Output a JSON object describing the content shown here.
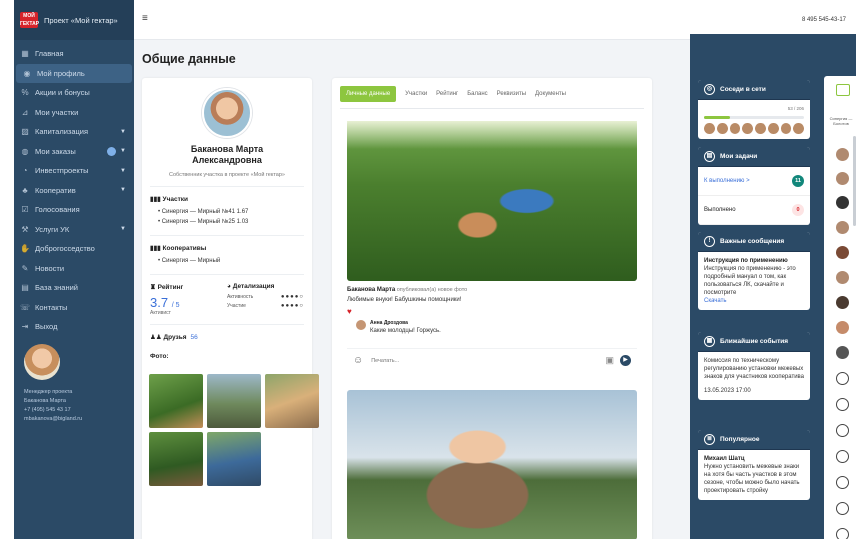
{
  "sidebar": {
    "title": "Проект «Мой гектар»",
    "logo_text": "МОЙ ГЕКТАР",
    "items": [
      {
        "label": "Главная",
        "icon": "grid-icon"
      },
      {
        "label": "Мой профиль",
        "icon": "user-icon",
        "active": true
      },
      {
        "label": "Акции и бонусы",
        "icon": "percent-icon"
      },
      {
        "label": "Мои участки",
        "icon": "plot-icon"
      },
      {
        "label": "Капитализация",
        "icon": "chart-icon",
        "expandable": true
      },
      {
        "label": "Мои заказы",
        "icon": "cart-icon",
        "expandable": true,
        "dot": true
      },
      {
        "label": "Инвестпроекты",
        "icon": "invest-icon",
        "expandable": true
      },
      {
        "label": "Кооператив",
        "icon": "coop-icon",
        "expandable": true
      },
      {
        "label": "Голосования",
        "icon": "vote-icon"
      },
      {
        "label": "Услуги УК",
        "icon": "service-icon",
        "expandable": true
      },
      {
        "label": "Доброгосседство",
        "icon": "handshake-icon"
      },
      {
        "label": "Новости",
        "icon": "news-icon"
      },
      {
        "label": "База знаний",
        "icon": "book-icon"
      },
      {
        "label": "Контакты",
        "icon": "contacts-icon"
      },
      {
        "label": "Выход",
        "icon": "logout-icon"
      }
    ],
    "manager": {
      "role": "Менеджер проекта",
      "name": "Баканова Марта",
      "phone": "+7 (495) 545 43 17",
      "email": "mbakanova@bigland.ru"
    }
  },
  "topbar": {
    "phone": "8 495 545-43-17"
  },
  "page_title": "Общие данные",
  "profile": {
    "name_line1": "Баканова Марта",
    "name_line2": "Александровна",
    "role": "Собственник участка в проекте «Мой гектар»",
    "plots_heading": "Участки",
    "plots": [
      "Синергия — Мирный №41 1.67",
      "Синергия — Мирный №25 1.03"
    ],
    "coops_heading": "Кооперативы",
    "coops": [
      "Синергия — Мирный"
    ],
    "rating_heading": "Рейтинг",
    "rating_value": "3.7",
    "rating_max": "/ 5",
    "rating_status": "Активист",
    "detail_heading": "Детализация",
    "activity_label": "Активность",
    "activity_dots": "●●●●○",
    "participation_label": "Участие",
    "participation_dots": "●●●●○",
    "friends_label": "Друзья",
    "friends_count": "56",
    "photos_label": "Фото:"
  },
  "feed": {
    "tabs": [
      "Личные данные",
      "Участки",
      "Рейтинг",
      "Баланс",
      "Реквизиты",
      "Документы"
    ],
    "post_author": "Баканова Марта",
    "post_action": "опубликовал(а) новое фото",
    "post_text": "Любимые внуки! Бабушкины помощники!",
    "comment_author": "Анна Дроздова",
    "comment_text": "Какие молодцы! Горжусь.",
    "composer_placeholder": "Печатать..."
  },
  "widgets": {
    "neighbors": {
      "title": "Соседи в сети",
      "progress_label": "53 / 206",
      "progress": 0.26
    },
    "tasks": {
      "title": "Мои задачи",
      "todo_label": "К выполнению >",
      "todo_count": "11",
      "done_label": "Выполнено",
      "done_count": "0"
    },
    "messages": {
      "title": "Важные сообщения",
      "heading": "Инструкция по применению",
      "text": "Инструкция по применению - это подробный мануал о том, как пользоваться ЛК, скачайте и посмотрите",
      "link": "Скачать"
    },
    "events": {
      "title": "Ближайшие события",
      "text": "Комиссия по техническому регулированию установки межевых знаков для участников кооператива",
      "date": "13.05.2023   17:00"
    },
    "popular": {
      "title": "Популярное",
      "author": "Михаил Шатц",
      "text": "Нужно установить межевые знаки на хотя бы часть участков в этом сезоне, чтобы можно было начать проектировать стройку"
    }
  },
  "strip": {
    "label": "Синергия — Болотов"
  },
  "colors": {
    "sidebar": "#2b4a66",
    "accent_green": "#8dc63f",
    "link": "#3a6fd8",
    "brand_red": "#d6232a"
  }
}
